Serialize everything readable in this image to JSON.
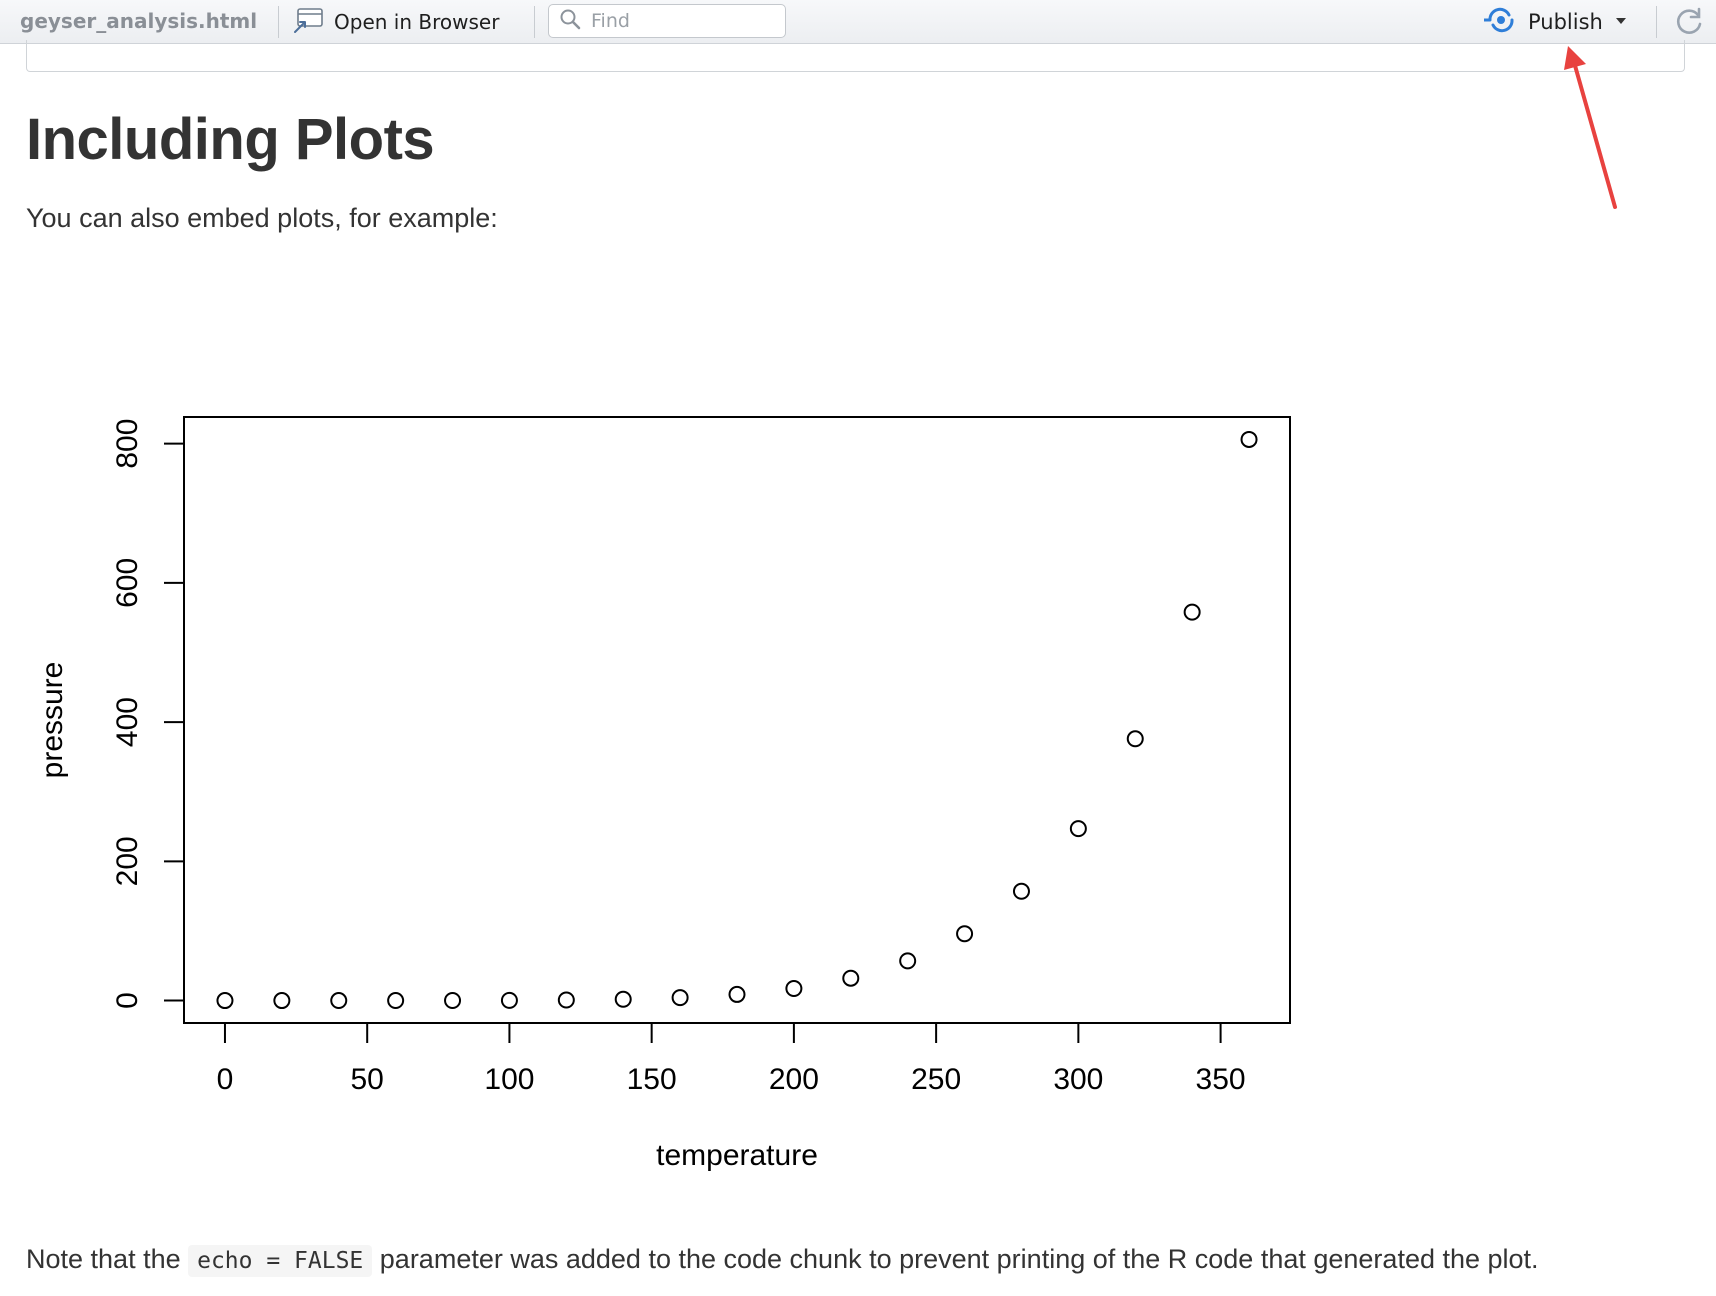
{
  "toolbar": {
    "filename": "geyser_analysis.html",
    "open_in_browser_label": "Open in Browser",
    "find_placeholder": "Find",
    "publish_label": "Publish"
  },
  "content": {
    "heading": "Including Plots",
    "intro": "You can also embed plots, for example:",
    "note_before": "Note that the ",
    "note_code": "echo = FALSE",
    "note_after": " parameter was added to the code chunk to prevent printing of the R code that generated the plot."
  },
  "annotation": {
    "arrow_color": "#e8423f",
    "points_to": "publish-button"
  },
  "chart_data": {
    "type": "scatter",
    "title": "",
    "xlabel": "temperature",
    "ylabel": "pressure",
    "x": [
      0,
      20,
      40,
      60,
      80,
      100,
      120,
      140,
      160,
      180,
      200,
      220,
      240,
      260,
      280,
      300,
      320,
      340,
      360
    ],
    "y": [
      0.0002,
      0.0012,
      0.006,
      0.03,
      0.09,
      0.27,
      0.75,
      1.85,
      4.2,
      8.8,
      17.3,
      32.1,
      57,
      96,
      157,
      247,
      376,
      558,
      806
    ],
    "xticks": [
      0,
      50,
      100,
      150,
      200,
      250,
      300,
      350
    ],
    "yticks": [
      0,
      200,
      400,
      600,
      800
    ],
    "xlim": [
      -14.4,
      374.4
    ],
    "ylim": [
      -32.24,
      838.24
    ],
    "marker": "open-circle",
    "grid": false,
    "legend": "none",
    "colors": {
      "points": "#000000",
      "axes": "#000000"
    }
  }
}
